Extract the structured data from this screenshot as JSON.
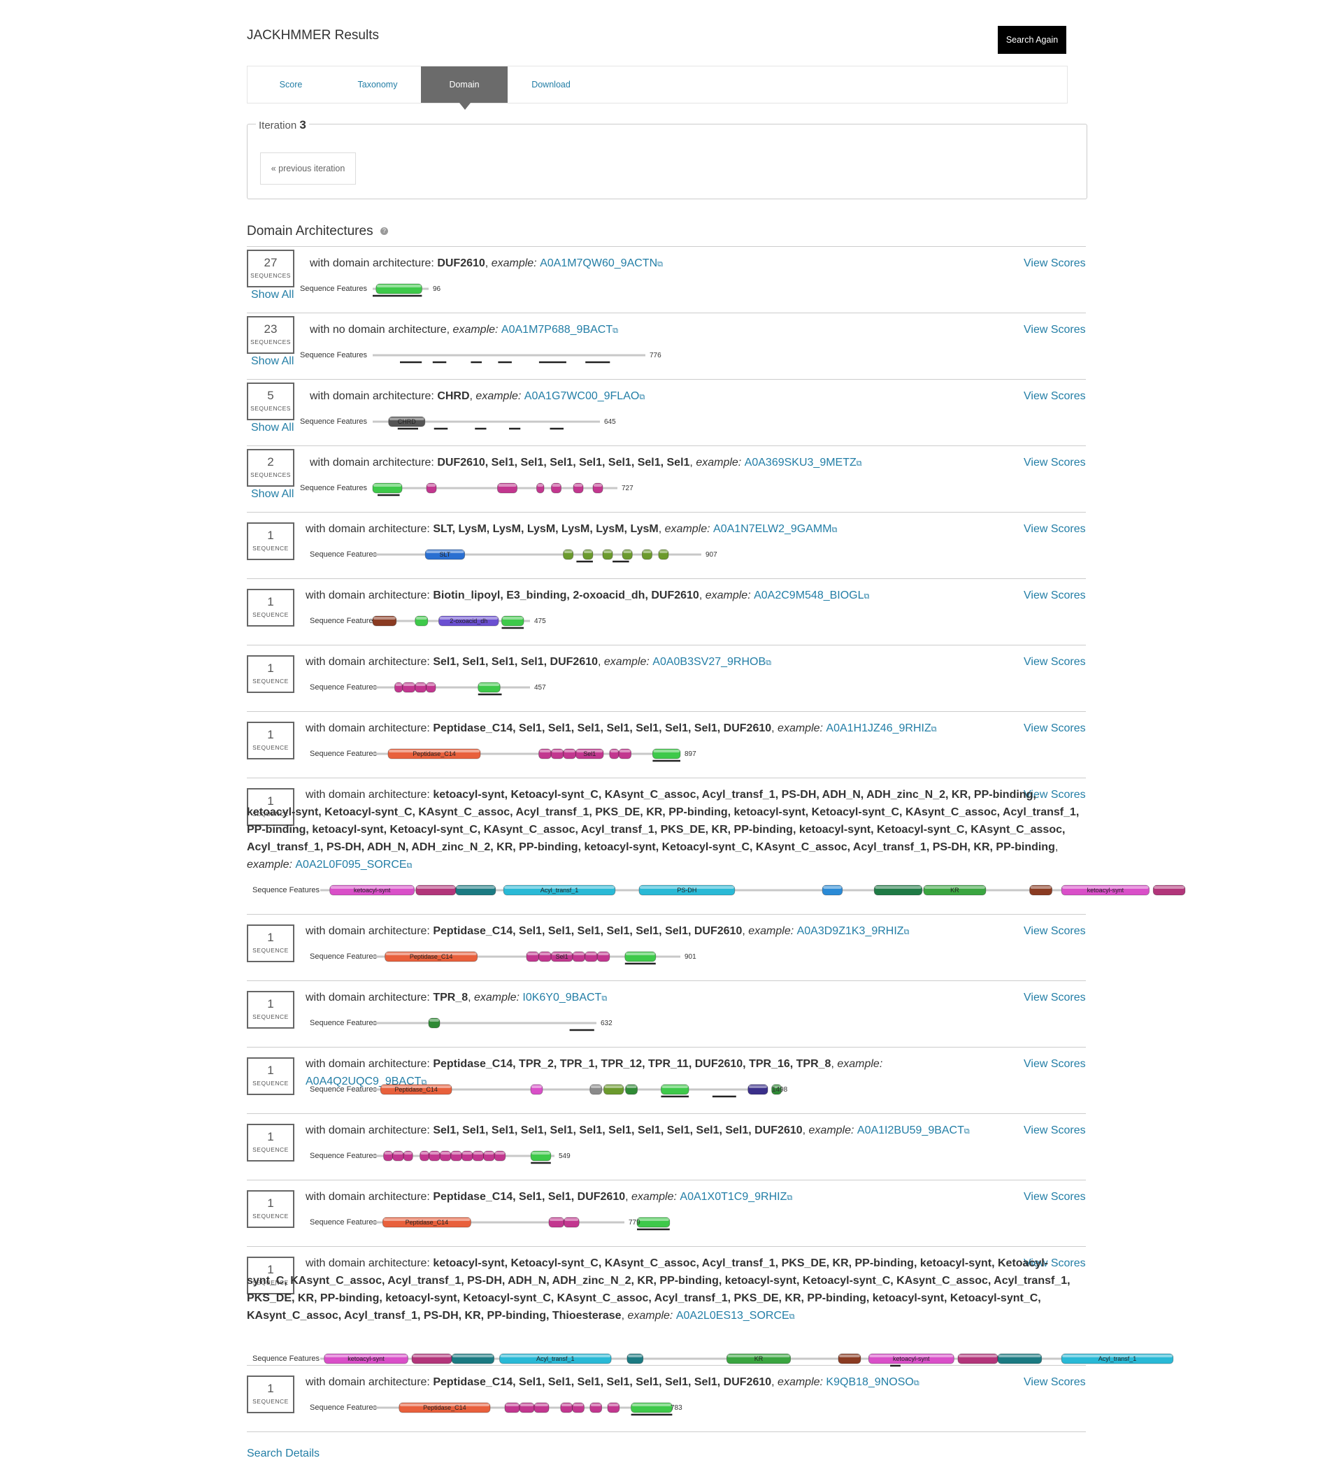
{
  "page": {
    "title": "JACKHMMER Results",
    "search_again": "Search Again",
    "tabs": [
      "Score",
      "Taxonomy",
      "Domain",
      "Download"
    ],
    "active_tab": "Domain",
    "iteration_label": "Iteration",
    "iteration_number": "3",
    "previous_iteration": "« previous iteration",
    "section_title": "Domain Architectures",
    "help_icon": "?",
    "search_details": "Search Details"
  },
  "labels": {
    "show_all": "Show All",
    "view_scores": "View Scores",
    "sequence_features": "Sequence Features",
    "with_domain": "with domain architecture: ",
    "with_no_domain": "with no domain architecture",
    "example": "example:",
    "ext_icon": "external-link-icon"
  },
  "architectures": [
    {
      "count": "27",
      "unit": "SEQUENCES",
      "show_all": true,
      "no_domain": false,
      "domains": "DUF2610",
      "example_id": "A0A1M7QW60_9ACTN",
      "length": "96",
      "features": [
        {
          "start": 0.06,
          "end": 0.88,
          "color": "#3ec94a",
          "label": ""
        }
      ],
      "marks": [
        {
          "start": 0.0,
          "end": 0.88
        }
      ]
    },
    {
      "count": "23",
      "unit": "SEQUENCES",
      "show_all": true,
      "no_domain": true,
      "domains": "",
      "example_id": "A0A1M7P688_9BACT",
      "length": "776",
      "features": [],
      "marks": [
        {
          "start": 0.1,
          "end": 0.18
        },
        {
          "start": 0.22,
          "end": 0.27
        },
        {
          "start": 0.36,
          "end": 0.4
        },
        {
          "start": 0.46,
          "end": 0.51
        },
        {
          "start": 0.61,
          "end": 0.71
        },
        {
          "start": 0.78,
          "end": 0.87
        }
      ]
    },
    {
      "count": "5",
      "unit": "SEQUENCES",
      "show_all": true,
      "no_domain": false,
      "domains": "CHRD",
      "example_id": "A0A1G7WC00_9FLAO",
      "length": "645",
      "features": [
        {
          "start": 0.07,
          "end": 0.23,
          "color": "#555555",
          "label": "CHRD"
        }
      ],
      "marks": [
        {
          "start": 0.11,
          "end": 0.2
        },
        {
          "start": 0.27,
          "end": 0.33
        },
        {
          "start": 0.45,
          "end": 0.5
        },
        {
          "start": 0.6,
          "end": 0.65
        },
        {
          "start": 0.78,
          "end": 0.84
        }
      ]
    },
    {
      "count": "2",
      "unit": "SEQUENCES",
      "show_all": true,
      "no_domain": false,
      "domains": "DUF2610, Sel1, Sel1, Sel1, Sel1, Sel1, Sel1, Sel1",
      "example_id": "A0A369SKU3_9METZ",
      "length": "727",
      "features": [
        {
          "start": 0.0,
          "end": 0.12,
          "color": "#3ec94a",
          "label": ""
        },
        {
          "start": 0.22,
          "end": 0.26,
          "color": "#c2378f",
          "label": ""
        },
        {
          "start": 0.51,
          "end": 0.59,
          "color": "#c2378f",
          "label": ""
        },
        {
          "start": 0.67,
          "end": 0.7,
          "color": "#c2378f",
          "label": ""
        },
        {
          "start": 0.73,
          "end": 0.77,
          "color": "#c2378f",
          "label": ""
        },
        {
          "start": 0.82,
          "end": 0.86,
          "color": "#c2378f",
          "label": ""
        },
        {
          "start": 0.9,
          "end": 0.94,
          "color": "#c2378f",
          "label": ""
        }
      ],
      "marks": [
        {
          "start": 0.02,
          "end": 0.11
        }
      ]
    },
    {
      "count": "1",
      "unit": "SEQUENCE",
      "show_all": false,
      "no_domain": false,
      "domains": "SLT, LysM, LysM, LysM, LysM, LysM, LysM",
      "example_id": "A0A1N7ELW2_9GAMM",
      "length": "907",
      "features": [
        {
          "start": 0.16,
          "end": 0.28,
          "color": "#2a6fd1",
          "label": "SLT"
        },
        {
          "start": 0.58,
          "end": 0.61,
          "color": "#6b9a2d",
          "label": ""
        },
        {
          "start": 0.64,
          "end": 0.67,
          "color": "#6b9a2d",
          "label": ""
        },
        {
          "start": 0.7,
          "end": 0.73,
          "color": "#6b9a2d",
          "label": ""
        },
        {
          "start": 0.76,
          "end": 0.79,
          "color": "#6b9a2d",
          "label": ""
        },
        {
          "start": 0.82,
          "end": 0.85,
          "color": "#6b9a2d",
          "label": ""
        },
        {
          "start": 0.87,
          "end": 0.9,
          "color": "#6b9a2d",
          "label": ""
        }
      ],
      "marks": [
        {
          "start": 0.62,
          "end": 0.67
        },
        {
          "start": 0.73,
          "end": 0.78
        }
      ]
    },
    {
      "count": "1",
      "unit": "SEQUENCE",
      "show_all": false,
      "no_domain": false,
      "domains": "Biotin_lipoyl, E3_binding, 2-oxoacid_dh, DUF2610",
      "example_id": "A0A2C9M548_BIOGL",
      "length": "475",
      "features": [
        {
          "start": 0.0,
          "end": 0.15,
          "color": "#8a3b22",
          "label": ""
        },
        {
          "start": 0.27,
          "end": 0.35,
          "color": "#3ec94a",
          "label": ""
        },
        {
          "start": 0.42,
          "end": 0.8,
          "color": "#6a4fd1",
          "label": "2-oxoacid_dh"
        },
        {
          "start": 0.82,
          "end": 0.96,
          "color": "#3ec94a",
          "label": ""
        }
      ],
      "marks": [
        {
          "start": 0.82,
          "end": 0.96
        }
      ]
    },
    {
      "count": "1",
      "unit": "SEQUENCE",
      "show_all": false,
      "no_domain": false,
      "domains": "Sel1, Sel1, Sel1, Sel1, DUF2610",
      "example_id": "A0A0B3SV27_9RHOB",
      "length": "457",
      "features": [
        {
          "start": 0.14,
          "end": 0.19,
          "color": "#c2378f",
          "label": ""
        },
        {
          "start": 0.19,
          "end": 0.27,
          "color": "#c2378f",
          "label": ""
        },
        {
          "start": 0.27,
          "end": 0.34,
          "color": "#c2378f",
          "label": ""
        },
        {
          "start": 0.34,
          "end": 0.4,
          "color": "#c2378f",
          "label": ""
        },
        {
          "start": 0.67,
          "end": 0.81,
          "color": "#3ec94a",
          "label": ""
        }
      ],
      "marks": [
        {
          "start": 0.67,
          "end": 0.82
        }
      ]
    },
    {
      "count": "1",
      "unit": "SEQUENCE",
      "show_all": false,
      "no_domain": false,
      "domains": "Peptidase_C14, Sel1, Sel1, Sel1, Sel1, Sel1, Sel1, Sel1, DUF2610",
      "example_id": "A0A1H1JZ46_9RHIZ",
      "length": "897",
      "features": [
        {
          "start": 0.05,
          "end": 0.35,
          "color": "#e8603c",
          "label": "Peptidase_C14"
        },
        {
          "start": 0.54,
          "end": 0.58,
          "color": "#c2378f",
          "label": ""
        },
        {
          "start": 0.58,
          "end": 0.62,
          "color": "#c2378f",
          "label": ""
        },
        {
          "start": 0.62,
          "end": 0.66,
          "color": "#c2378f",
          "label": ""
        },
        {
          "start": 0.66,
          "end": 0.75,
          "color": "#c2378f",
          "label": "Sel1"
        },
        {
          "start": 0.77,
          "end": 0.8,
          "color": "#c2378f",
          "label": ""
        },
        {
          "start": 0.8,
          "end": 0.84,
          "color": "#c2378f",
          "label": ""
        },
        {
          "start": 0.91,
          "end": 1.0,
          "color": "#3ec94a",
          "label": ""
        }
      ],
      "marks": [
        {
          "start": 0.91,
          "end": 1.0
        }
      ]
    },
    {
      "count": "1",
      "unit": "SEQUENCE",
      "show_all": false,
      "no_domain": false,
      "domains": "ketoacyl-synt, Ketoacyl-synt_C, KAsynt_C_assoc, Acyl_transf_1, PS-DH, ADH_N, ADH_zinc_N_2, KR, PP-binding, ketoacyl-synt, Ketoacyl-synt_C, KAsynt_C_assoc, Acyl_transf_1, PKS_DE, KR, PP-binding, ketoacyl-synt, Ketoacyl-synt_C, KAsynt_C_assoc, Acyl_transf_1, PP-binding, ketoacyl-synt, Ketoacyl-synt_C, KAsynt_C_assoc, Acyl_transf_1, PKS_DE, KR, PP-binding, ketoacyl-synt, Ketoacyl-synt_C, KAsynt_C_assoc, Acyl_transf_1, PS-DH, ADH_N, ADH_zinc_N_2, KR, PP-binding, ketoacyl-synt, Ketoacyl-synt_C, KAsynt_C_assoc, Acyl_transf_1, PS-DH, KR, PP-binding",
      "example_id": "A0A2L0F095_SORCE",
      "length": "",
      "features": [
        {
          "start": 0.012,
          "end": 0.118,
          "color": "#d94fc8",
          "label": "ketoacyl-synt"
        },
        {
          "start": 0.12,
          "end": 0.17,
          "color": "#b2357a",
          "label": ""
        },
        {
          "start": 0.17,
          "end": 0.22,
          "color": "#1b7a82",
          "label": ""
        },
        {
          "start": 0.23,
          "end": 0.37,
          "color": "#29b9d6",
          "label": "Acyl_transf_1"
        },
        {
          "start": 0.4,
          "end": 0.52,
          "color": "#29b9d6",
          "label": "PS-DH"
        },
        {
          "start": 0.63,
          "end": 0.655,
          "color": "#2a8ad6",
          "label": ""
        },
        {
          "start": 0.695,
          "end": 0.755,
          "color": "#1f7a45",
          "label": ""
        },
        {
          "start": 0.757,
          "end": 0.835,
          "color": "#3aa540",
          "label": "KR"
        },
        {
          "start": 0.89,
          "end": 0.918,
          "color": "#8a3b22",
          "label": ""
        },
        {
          "start": 0.93,
          "end": 1.04,
          "color": "#d94fc8",
          "label": "ketoacyl-synt"
        },
        {
          "start": 1.045,
          "end": 1.085,
          "color": "#b2357a",
          "label": ""
        }
      ],
      "marks": []
    },
    {
      "count": "1",
      "unit": "SEQUENCE",
      "show_all": false,
      "no_domain": false,
      "domains": "Peptidase_C14, Sel1, Sel1, Sel1, Sel1, Sel1, Sel1, DUF2610",
      "example_id": "A0A3D9Z1K3_9RHIZ",
      "length": "901",
      "features": [
        {
          "start": 0.04,
          "end": 0.34,
          "color": "#e8603c",
          "label": "Peptidase_C14"
        },
        {
          "start": 0.5,
          "end": 0.54,
          "color": "#c2378f",
          "label": ""
        },
        {
          "start": 0.54,
          "end": 0.58,
          "color": "#c2378f",
          "label": ""
        },
        {
          "start": 0.58,
          "end": 0.65,
          "color": "#c2378f",
          "label": "Sel1"
        },
        {
          "start": 0.65,
          "end": 0.69,
          "color": "#c2378f",
          "label": ""
        },
        {
          "start": 0.69,
          "end": 0.73,
          "color": "#c2378f",
          "label": ""
        },
        {
          "start": 0.73,
          "end": 0.77,
          "color": "#c2378f",
          "label": ""
        },
        {
          "start": 0.82,
          "end": 0.92,
          "color": "#3ec94a",
          "label": ""
        }
      ],
      "marks": [
        {
          "start": 0.82,
          "end": 0.92
        }
      ]
    },
    {
      "count": "1",
      "unit": "SEQUENCE",
      "show_all": false,
      "no_domain": false,
      "domains": "TPR_8",
      "example_id": "I0K6Y0_9BACT",
      "length": "632",
      "features": [
        {
          "start": 0.25,
          "end": 0.3,
          "color": "#2f8a35",
          "label": ""
        }
      ],
      "marks": [
        {
          "start": 0.88,
          "end": 0.99
        }
      ]
    },
    {
      "count": "1",
      "unit": "SEQUENCE",
      "show_all": false,
      "no_domain": false,
      "domains": "Peptidase_C14, TPR_2, TPR_1, TPR_12, TPR_11, DUF2610, TPR_16, TPR_8",
      "example_id": "A0A4Q2UQC9_9BACT",
      "length": "1498",
      "features": [
        {
          "start": 0.02,
          "end": 0.2,
          "color": "#e8603c",
          "label": "Peptidase_C14"
        },
        {
          "start": 0.4,
          "end": 0.43,
          "color": "#d94fc8",
          "label": ""
        },
        {
          "start": 0.55,
          "end": 0.58,
          "color": "#8a8a8a",
          "label": ""
        },
        {
          "start": 0.585,
          "end": 0.635,
          "color": "#6b9a2d",
          "label": ""
        },
        {
          "start": 0.64,
          "end": 0.67,
          "color": "#2f8a35",
          "label": ""
        },
        {
          "start": 0.73,
          "end": 0.8,
          "color": "#3ec94a",
          "label": ""
        },
        {
          "start": 0.95,
          "end": 1.0,
          "color": "#3a2f8a",
          "label": ""
        },
        {
          "start": 1.01,
          "end": 1.035,
          "color": "#2f8a35",
          "label": ""
        }
      ],
      "marks": [
        {
          "start": 0.73,
          "end": 0.8
        },
        {
          "start": 0.86,
          "end": 0.92
        }
      ]
    },
    {
      "count": "1",
      "unit": "SEQUENCE",
      "show_all": false,
      "no_domain": false,
      "domains": "Sel1, Sel1, Sel1, Sel1, Sel1, Sel1, Sel1, Sel1, Sel1, Sel1, Sel1, DUF2610",
      "example_id": "A0A1I2BU59_9BACT",
      "length": "549",
      "features": [
        {
          "start": 0.06,
          "end": 0.11,
          "color": "#c2378f",
          "label": ""
        },
        {
          "start": 0.11,
          "end": 0.17,
          "color": "#c2378f",
          "label": ""
        },
        {
          "start": 0.17,
          "end": 0.22,
          "color": "#c2378f",
          "label": ""
        },
        {
          "start": 0.26,
          "end": 0.31,
          "color": "#c2378f",
          "label": ""
        },
        {
          "start": 0.31,
          "end": 0.37,
          "color": "#c2378f",
          "label": ""
        },
        {
          "start": 0.37,
          "end": 0.43,
          "color": "#c2378f",
          "label": ""
        },
        {
          "start": 0.43,
          "end": 0.49,
          "color": "#c2378f",
          "label": ""
        },
        {
          "start": 0.49,
          "end": 0.55,
          "color": "#c2378f",
          "label": ""
        },
        {
          "start": 0.55,
          "end": 0.61,
          "color": "#c2378f",
          "label": ""
        },
        {
          "start": 0.61,
          "end": 0.67,
          "color": "#c2378f",
          "label": ""
        },
        {
          "start": 0.67,
          "end": 0.73,
          "color": "#c2378f",
          "label": ""
        },
        {
          "start": 0.87,
          "end": 0.98,
          "color": "#3ec94a",
          "label": ""
        }
      ],
      "marks": [
        {
          "start": 0.87,
          "end": 0.98
        }
      ]
    },
    {
      "count": "1",
      "unit": "SEQUENCE",
      "show_all": false,
      "no_domain": false,
      "domains": "Peptidase_C14, Sel1, Sel1, DUF2610",
      "example_id": "A0A1X0T1C9_9RHIZ",
      "length": "779",
      "features": [
        {
          "start": 0.04,
          "end": 0.39,
          "color": "#e8603c",
          "label": "Peptidase_C14"
        },
        {
          "start": 0.7,
          "end": 0.76,
          "color": "#c2378f",
          "label": ""
        },
        {
          "start": 0.76,
          "end": 0.82,
          "color": "#c2378f",
          "label": ""
        },
        {
          "start": 1.05,
          "end": 1.18,
          "color": "#3ec94a",
          "label": ""
        }
      ],
      "marks": [
        {
          "start": 1.05,
          "end": 1.18
        }
      ]
    },
    {
      "count": "1",
      "unit": "SEQUENCE",
      "show_all": false,
      "no_domain": false,
      "domains": "ketoacyl-synt, Ketoacyl-synt_C, KAsynt_C_assoc, Acyl_transf_1, PKS_DE, KR, PP-binding, ketoacyl-synt, Ketoacyl-synt_C, KAsynt_C_assoc, Acyl_transf_1, PS-DH, ADH_N, ADH_zinc_N_2, KR, PP-binding, ketoacyl-synt, Ketoacyl-synt_C, KAsynt_C_assoc, Acyl_transf_1, PKS_DE, KR, PP-binding, ketoacyl-synt, Ketoacyl-synt_C, KAsynt_C_assoc, Acyl_transf_1, PKS_DE, KR, PP-binding, ketoacyl-synt, Ketoacyl-synt_C, KAsynt_C_assoc, Acyl_transf_1, PS-DH, KR, PP-binding, Thioesterase",
      "example_id": "A0A2L0ES13_SORCE",
      "length": "",
      "features": [
        {
          "start": 0.005,
          "end": 0.11,
          "color": "#d94fc8",
          "label": "ketoacyl-synt"
        },
        {
          "start": 0.115,
          "end": 0.165,
          "color": "#b2357a",
          "label": ""
        },
        {
          "start": 0.165,
          "end": 0.218,
          "color": "#1b7a82",
          "label": ""
        },
        {
          "start": 0.225,
          "end": 0.365,
          "color": "#29b9d6",
          "label": "Acyl_transf_1"
        },
        {
          "start": 0.385,
          "end": 0.405,
          "color": "#1b7a82",
          "label": ""
        },
        {
          "start": 0.51,
          "end": 0.59,
          "color": "#3aa540",
          "label": "KR"
        },
        {
          "start": 0.65,
          "end": 0.678,
          "color": "#8a3b22",
          "label": ""
        },
        {
          "start": 0.688,
          "end": 0.795,
          "color": "#d94fc8",
          "label": "ketoacyl-synt"
        },
        {
          "start": 0.8,
          "end": 0.85,
          "color": "#b2357a",
          "label": ""
        },
        {
          "start": 0.85,
          "end": 0.905,
          "color": "#1b7a82",
          "label": ""
        },
        {
          "start": 0.93,
          "end": 1.07,
          "color": "#29b9d6",
          "label": "Acyl_transf_1"
        }
      ],
      "marks": [
        {
          "start": 0.715,
          "end": 0.728
        }
      ]
    },
    {
      "count": "1",
      "unit": "SEQUENCE",
      "show_all": false,
      "no_domain": false,
      "domains": "Peptidase_C14, Sel1, Sel1, Sel1, Sel1, Sel1, Sel1, Sel1, DUF2610",
      "example_id": "K9QB18_9NOSO",
      "length": "783",
      "features": [
        {
          "start": 0.09,
          "end": 0.4,
          "color": "#e8603c",
          "label": "Peptidase_C14"
        },
        {
          "start": 0.45,
          "end": 0.5,
          "color": "#c2378f",
          "label": ""
        },
        {
          "start": 0.5,
          "end": 0.55,
          "color": "#c2378f",
          "label": ""
        },
        {
          "start": 0.55,
          "end": 0.6,
          "color": "#c2378f",
          "label": ""
        },
        {
          "start": 0.64,
          "end": 0.68,
          "color": "#c2378f",
          "label": ""
        },
        {
          "start": 0.68,
          "end": 0.72,
          "color": "#c2378f",
          "label": ""
        },
        {
          "start": 0.74,
          "end": 0.78,
          "color": "#c2378f",
          "label": ""
        },
        {
          "start": 0.8,
          "end": 0.84,
          "color": "#c2378f",
          "label": ""
        },
        {
          "start": 0.88,
          "end": 1.02,
          "color": "#3ec94a",
          "label": ""
        }
      ],
      "marks": [
        {
          "start": 0.88,
          "end": 1.02
        }
      ]
    }
  ]
}
